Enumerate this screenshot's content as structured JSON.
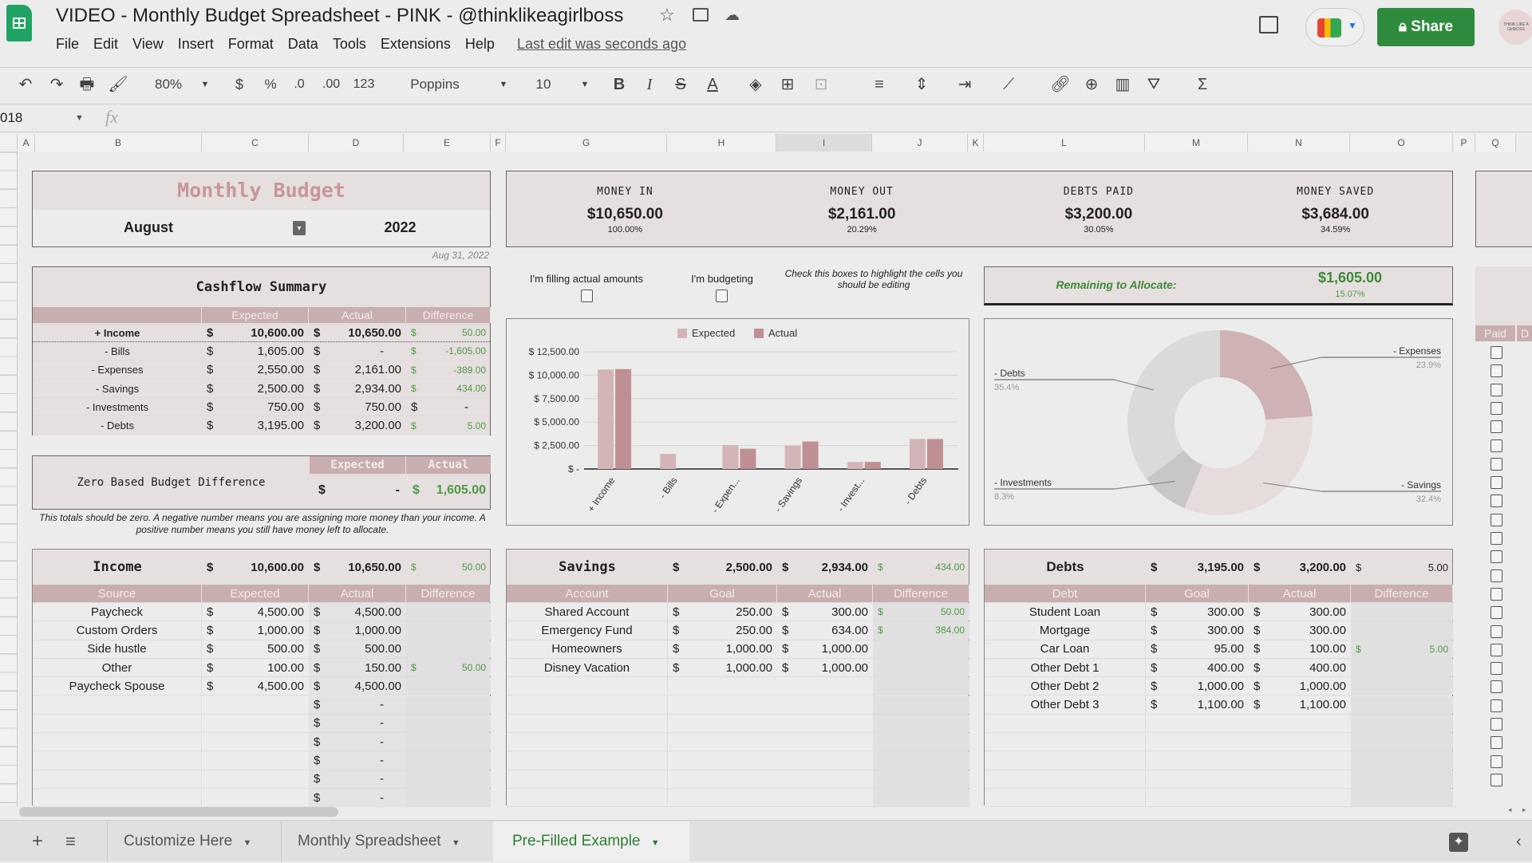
{
  "app": {
    "title": "VIDEO - Monthly Budget Spreadsheet - PINK - @thinklikeagirlboss",
    "last_edit": "Last edit was seconds ago",
    "share": "Share",
    "avatar_text": "THINK LIKE A GirlBOSS",
    "menu": [
      "File",
      "Edit",
      "View",
      "Insert",
      "Format",
      "Data",
      "Tools",
      "Extensions",
      "Help"
    ]
  },
  "toolbar": {
    "zoom": "80%",
    "currency": "$",
    "percent": "%",
    "dec_less": ".0",
    "dec_more": ".00",
    "format": "123",
    "font": "Poppins",
    "size": "10",
    "bold": "B",
    "italic": "I",
    "strike": "S",
    "text_color": "A"
  },
  "formula": {
    "name_box": "018",
    "fx": "fx"
  },
  "columns": [
    "A",
    "B",
    "C",
    "D",
    "E",
    "F",
    "G",
    "H",
    "I",
    "J",
    "K",
    "L",
    "M",
    "N",
    "O",
    "P",
    "Q"
  ],
  "header": {
    "title": "Monthly Budget",
    "month": "August",
    "year": "2022",
    "date": "Aug 31, 2022"
  },
  "kpis": [
    {
      "label": "MONEY IN",
      "value": "$10,650.00",
      "pct": "100.00%"
    },
    {
      "label": "MONEY OUT",
      "value": "$2,161.00",
      "pct": "20.29%"
    },
    {
      "label": "DEBTS PAID",
      "value": "$3,200.00",
      "pct": "30.05%"
    },
    {
      "label": "MONEY SAVED",
      "value": "$3,684.00",
      "pct": "34.59%"
    }
  ],
  "checks": {
    "filling": "I'm filling actual amounts",
    "budgeting": "I'm budgeting",
    "hint": "Check this boxes to highlight the cells you should be editing"
  },
  "remaining": {
    "label": "Remaining to Allocate:",
    "value": "$1,605.00",
    "pct": "15.07%"
  },
  "cashflow": {
    "title": "Cashflow Summary",
    "columns": [
      "",
      "Expected",
      "Actual",
      "Difference"
    ],
    "rows": [
      [
        "+ Income",
        "10,600.00",
        "10,650.00",
        "50.00"
      ],
      [
        "- Bills",
        "1,605.00",
        "-",
        "-1,605.00"
      ],
      [
        "- Expenses",
        "2,550.00",
        "2,161.00",
        "-389.00"
      ],
      [
        "- Savings",
        "2,500.00",
        "2,934.00",
        "434.00"
      ],
      [
        "- Investments",
        "750.00",
        "750.00",
        "-"
      ],
      [
        "- Debts",
        "3,195.00",
        "3,200.00",
        "5.00"
      ]
    ]
  },
  "zero": {
    "label": "Zero Based Budget Difference",
    "columns": [
      "Expected",
      "Actual"
    ],
    "expected": "-",
    "actual": "1,605.00",
    "note": "This totals should be zero. A negative number means you are assigning more money than your income. A positive number means you still have money left to allocate."
  },
  "income": {
    "title": "Income",
    "expected": "10,600.00",
    "actual": "10,650.00",
    "diff": "50.00",
    "columns": [
      "Source",
      "Expected",
      "Actual",
      "Difference"
    ],
    "rows": [
      [
        "Paycheck",
        "4,500.00",
        "4,500.00",
        ""
      ],
      [
        "Custom Orders",
        "1,000.00",
        "1,000.00",
        ""
      ],
      [
        "Side hustle",
        "500.00",
        "500.00",
        ""
      ],
      [
        "Other",
        "100.00",
        "150.00",
        "50.00"
      ],
      [
        "Paycheck Spouse",
        "4,500.00",
        "4,500.00",
        ""
      ],
      [
        "",
        "",
        "-",
        ""
      ],
      [
        "",
        "",
        "-",
        ""
      ],
      [
        "",
        "",
        "-",
        ""
      ],
      [
        "",
        "",
        "-",
        ""
      ],
      [
        "",
        "",
        "-",
        ""
      ],
      [
        "",
        "",
        "-",
        ""
      ]
    ]
  },
  "savings": {
    "title": "Savings",
    "expected": "2,500.00",
    "actual": "2,934.00",
    "diff": "434.00",
    "columns": [
      "Account",
      "Goal",
      "Actual",
      "Difference"
    ],
    "rows": [
      [
        "Shared Account",
        "250.00",
        "300.00",
        "50.00"
      ],
      [
        "Emergency Fund",
        "250.00",
        "634.00",
        "384.00"
      ],
      [
        "Homeowners",
        "1,000.00",
        "1,000.00",
        ""
      ],
      [
        "Disney Vacation",
        "1,000.00",
        "1,000.00",
        ""
      ],
      [
        "",
        "",
        "",
        ""
      ],
      [
        "",
        "",
        "",
        ""
      ],
      [
        "",
        "",
        "",
        ""
      ],
      [
        "",
        "",
        "",
        ""
      ],
      [
        "",
        "",
        "",
        ""
      ],
      [
        "",
        "",
        "",
        ""
      ],
      [
        "",
        "",
        "",
        ""
      ]
    ]
  },
  "debts": {
    "title": "Debts",
    "expected": "3,195.00",
    "actual": "3,200.00",
    "diff": "5.00",
    "columns": [
      "Debt",
      "Goal",
      "Actual",
      "Difference"
    ],
    "rows": [
      [
        "Student Loan",
        "300.00",
        "300.00",
        ""
      ],
      [
        "Mortgage",
        "300.00",
        "300.00",
        ""
      ],
      [
        "Car Loan",
        "95.00",
        "100.00",
        "5.00"
      ],
      [
        "Other Debt 1",
        "400.00",
        "400.00",
        ""
      ],
      [
        "Other Debt 2",
        "1,000.00",
        "1,000.00",
        ""
      ],
      [
        "Other Debt 3",
        "1,100.00",
        "1,100.00",
        ""
      ],
      [
        "",
        "",
        "",
        ""
      ],
      [
        "",
        "",
        "",
        ""
      ],
      [
        "",
        "",
        "",
        ""
      ],
      [
        "",
        "",
        "",
        ""
      ],
      [
        "",
        "",
        "",
        ""
      ]
    ]
  },
  "paid": {
    "header": "Paid",
    "next_header": "D",
    "count": 24
  },
  "chart_data": [
    {
      "type": "bar",
      "categories": [
        "+ Income",
        "- Bills",
        "- Expen...",
        "- Savings",
        "- Invest...",
        "- Debts"
      ],
      "series": [
        {
          "name": "Expected",
          "values": [
            10600,
            1605,
            2550,
            2500,
            750,
            3195
          ],
          "color": "#d4b5b7"
        },
        {
          "name": "Actual",
          "values": [
            10650,
            0,
            2161,
            2934,
            750,
            3200
          ],
          "color": "#bf9093"
        }
      ],
      "yticks": [
        "$ -",
        "$ 2,500.00",
        "$ 5,000.00",
        "$ 7,500.00",
        "$ 10,000.00",
        "$ 12,500.00"
      ],
      "ylim": [
        0,
        12500
      ],
      "grid": true,
      "legend": "top"
    },
    {
      "type": "pie",
      "donut": true,
      "slices": [
        {
          "label": "- Expenses",
          "pct": "23.9%",
          "value": 23.9,
          "color": "#cfb2b4"
        },
        {
          "label": "- Savings",
          "pct": "32.4%",
          "value": 32.4,
          "color": "#e6dcdc"
        },
        {
          "label": "- Investments",
          "pct": "8.3%",
          "value": 8.3,
          "color": "#c9c6c6"
        },
        {
          "label": "- Debts",
          "pct": "35.4%",
          "value": 35.4,
          "color": "#dcd9d9"
        }
      ]
    }
  ],
  "tabs": {
    "add": "+",
    "list": "≡",
    "items": [
      "Customize Here",
      "Monthly Spreadsheet",
      "Pre-Filled Example"
    ],
    "active": 2
  },
  "colors": {
    "accent_pink": "#c9aeb0",
    "title_pink": "#c9959a",
    "green": "#4f9a45",
    "share": "#2e8b3e"
  }
}
